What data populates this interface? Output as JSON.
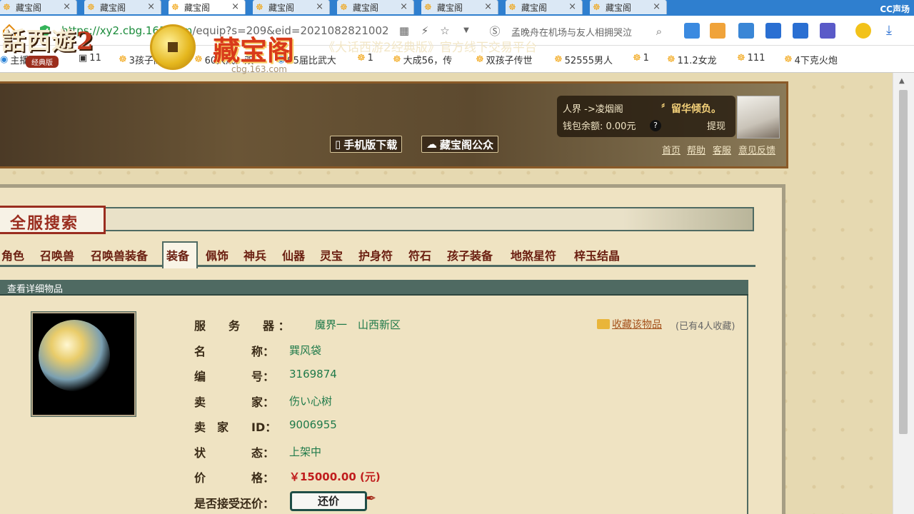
{
  "browser": {
    "tabs": [
      {
        "label": "藏宝阁"
      },
      {
        "label": "藏宝阁"
      },
      {
        "label": "藏宝阁"
      },
      {
        "label": "藏宝阁"
      },
      {
        "label": "藏宝阁"
      },
      {
        "label": "藏宝阁"
      },
      {
        "label": "藏宝阁"
      },
      {
        "label": "藏宝阁"
      }
    ],
    "corner_logo": "CC声场",
    "url_host": "https://xy2.cbg.163.com",
    "url_path": "/equip?s=209&eid=2021082821002",
    "search_text": "孟晚舟在机场与友人相拥哭泣",
    "bookmarks": [
      {
        "label": "主播公会服"
      },
      {
        "label": "11"
      },
      {
        "label": "3孩子高亲"
      },
      {
        "label": "60大成。双"
      },
      {
        "label": "95届比武大"
      },
      {
        "label": "1"
      },
      {
        "label": "大成56，传"
      },
      {
        "label": "双孩子传世"
      },
      {
        "label": "52555男人"
      },
      {
        "label": "1"
      },
      {
        "label": "11.2女龙"
      },
      {
        "label": "111"
      },
      {
        "label": "4下克火炮"
      }
    ]
  },
  "banner": {
    "game_logo": "話西遊",
    "game_logo_num": "2",
    "game_logo_sub": "经典版",
    "site_name": "藏宝阁",
    "site_domain": "cbg.163.com",
    "slogan": "《大话西游2经典版》官方线下交易平台",
    "mobile_btn": "手机版下载",
    "wechat_btn": "藏宝阁公众",
    "user_realm": "人界 ->凌烟阁",
    "user_name": "〞留华倾负。",
    "wallet": "钱包余额: 0.00元",
    "help": "?",
    "withdraw": "提现",
    "links": [
      "首页",
      "帮助",
      "客服",
      "意见反馈"
    ]
  },
  "search": {
    "title": "全服搜索",
    "categories": [
      "角色",
      "召唤兽",
      "召唤兽装备",
      "装备",
      "佩饰",
      "神兵",
      "仙器",
      "灵宝",
      "护身符",
      "符石",
      "孩子装备",
      "地煞星符",
      "梓玉结晶"
    ],
    "active_category": "装备"
  },
  "detail": {
    "header": "查看详细物品",
    "fav_label": "收藏该物品",
    "fav_count": "(已有4人收藏)",
    "fields": [
      {
        "label": "服　　务　　器 ：",
        "value": "魔界一　山西新区"
      },
      {
        "label": "名　　　　称：",
        "value": "巽风袋"
      },
      {
        "label": "编　　　　号：",
        "value": "3169874"
      },
      {
        "label": "卖　　　　家：",
        "value": "伤い心树"
      },
      {
        "label": "卖　家　　ID：",
        "value": "9006955"
      },
      {
        "label": "状　　　　态：",
        "value": "上架中"
      },
      {
        "label": "价　　　　格：",
        "value": "￥15000.00 (元)"
      },
      {
        "label": "是否接受还价：",
        "value": ""
      }
    ],
    "bargain_btn": "还价"
  }
}
